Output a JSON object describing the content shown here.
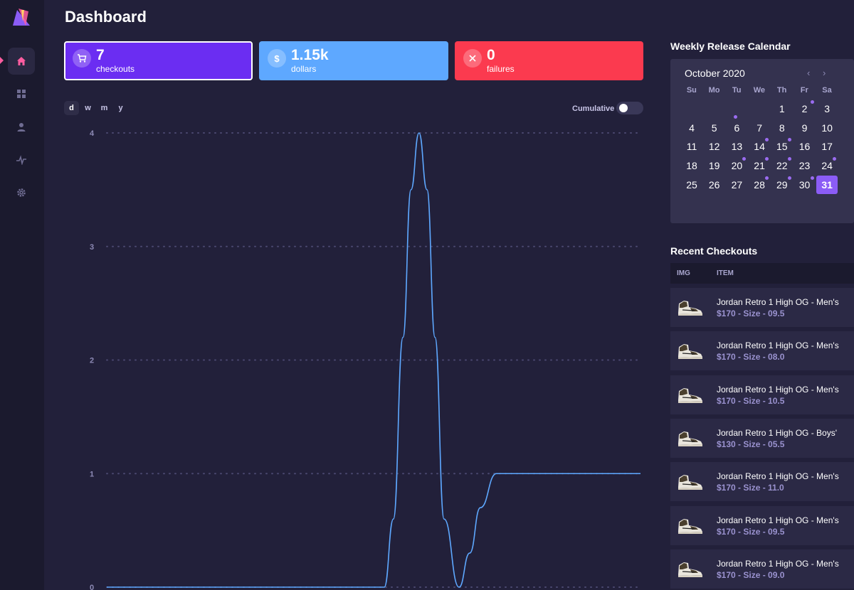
{
  "page": {
    "title": "Dashboard"
  },
  "colors": {
    "accent": "#6b2df2",
    "dollars": "#5ea8ff",
    "failures": "#fb3a4f",
    "line": "#5ea8ff",
    "nav_marker": "#ff5da0"
  },
  "sidebar": {
    "items": [
      {
        "icon": "home-icon",
        "active": true
      },
      {
        "icon": "grid-icon",
        "active": false
      },
      {
        "icon": "user-icon",
        "active": false
      },
      {
        "icon": "activity-icon",
        "active": false
      },
      {
        "icon": "gear-icon",
        "active": false
      }
    ]
  },
  "stats": {
    "checkouts": {
      "value": "7",
      "label": "checkouts",
      "icon": "cart-icon"
    },
    "dollars": {
      "value": "1.15k",
      "label": "dollars",
      "icon": "dollar-icon"
    },
    "failures": {
      "value": "0",
      "label": "failures",
      "icon": "x-icon"
    }
  },
  "range_tabs": [
    "d",
    "w",
    "m",
    "y"
  ],
  "cumulative": {
    "label": "Cumulative",
    "on": false
  },
  "chart_data": {
    "type": "line",
    "y_ticks": [
      "0",
      "1",
      "2",
      "3",
      "4"
    ],
    "ylim": [
      0,
      4
    ],
    "grid": true,
    "series": [
      {
        "values": [
          [
            0,
            0
          ],
          [
            0.52,
            0
          ],
          [
            0.537,
            0.6
          ],
          [
            0.555,
            2.2
          ],
          [
            0.57,
            3.5
          ],
          [
            0.585,
            4.0
          ],
          [
            0.6,
            3.5
          ],
          [
            0.615,
            2.2
          ],
          [
            0.632,
            0.6
          ],
          [
            0.66,
            0
          ],
          [
            0.68,
            0.3
          ],
          [
            0.7,
            0.7
          ],
          [
            0.73,
            1
          ],
          [
            1,
            1
          ]
        ]
      }
    ]
  },
  "calendar": {
    "title": "Weekly Release Calendar",
    "month": "October 2020",
    "prev": "‹",
    "next": "›",
    "dows": [
      "Su",
      "Mo",
      "Tu",
      "We",
      "Th",
      "Fr",
      "Sa"
    ],
    "first_weekday": 4,
    "days": 31,
    "selected": 31,
    "dots": [
      2,
      14,
      15,
      20,
      21,
      22,
      24,
      28,
      29,
      30
    ],
    "low_dots": [
      0
    ]
  },
  "checkouts": {
    "title": "Recent Checkouts",
    "headers": {
      "img": "IMG",
      "item": "ITEM"
    },
    "rows": [
      {
        "name": "Jordan Retro 1 High OG - Men's",
        "sub": "$170 - Size - 09.5"
      },
      {
        "name": "Jordan Retro 1 High OG - Men's",
        "sub": "$170 - Size - 08.0"
      },
      {
        "name": "Jordan Retro 1 High OG - Men's",
        "sub": "$170 - Size - 10.5"
      },
      {
        "name": "Jordan Retro 1 High OG - Boys'",
        "sub": "$130 - Size - 05.5"
      },
      {
        "name": "Jordan Retro 1 High OG - Men's",
        "sub": "$170 - Size - 11.0"
      },
      {
        "name": "Jordan Retro 1 High OG - Men's",
        "sub": "$170 - Size - 09.5"
      },
      {
        "name": "Jordan Retro 1 High OG - Men's",
        "sub": "$170 - Size - 09.0"
      }
    ]
  }
}
